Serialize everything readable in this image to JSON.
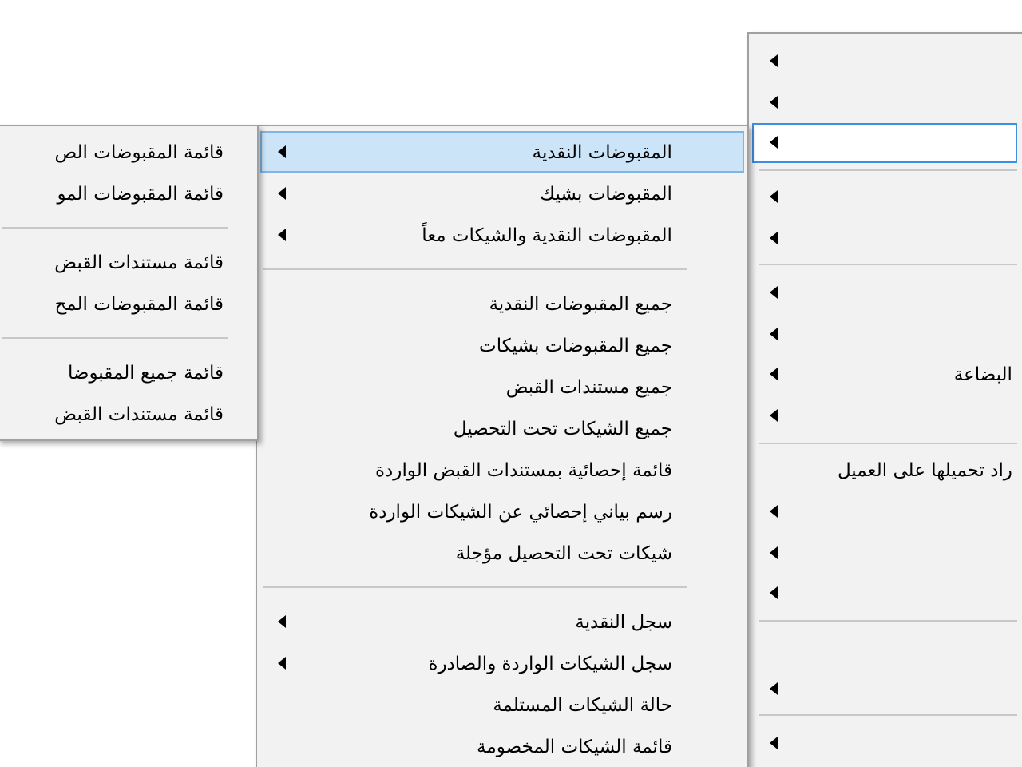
{
  "menus": [
    {
      "active": false,
      "items": [
        {
          "kind": "item",
          "submenu": true,
          "selected": false
        },
        {
          "kind": "item",
          "submenu": true,
          "selected": false
        },
        {
          "kind": "item",
          "submenu": true,
          "selected": true
        },
        {
          "kind": "separator"
        },
        {
          "kind": "item",
          "submenu": true,
          "selected": false
        },
        {
          "kind": "item",
          "submenu": true,
          "selected": false
        },
        {
          "kind": "separator"
        },
        {
          "kind": "item",
          "submenu": true,
          "selected": false
        },
        {
          "kind": "item",
          "submenu": true,
          "selected": false
        },
        {
          "kind": "item",
          "label": "البضاعة",
          "submenu": true,
          "selected": false
        },
        {
          "kind": "item",
          "submenu": true,
          "selected": false
        },
        {
          "kind": "separator"
        },
        {
          "kind": "item",
          "label": "راد تحميلها على العميل",
          "submenu": false,
          "selected": false
        },
        {
          "kind": "item",
          "submenu": true,
          "selected": false
        },
        {
          "kind": "item",
          "submenu": true,
          "selected": false
        },
        {
          "kind": "item",
          "submenu": true,
          "selected": false
        },
        {
          "kind": "separator"
        },
        {
          "kind": "blank"
        },
        {
          "kind": "item",
          "submenu": true,
          "selected": false
        },
        {
          "kind": "separator"
        },
        {
          "kind": "item",
          "submenu": true,
          "selected": false
        }
      ]
    },
    {
      "active": true,
      "items": [
        {
          "kind": "item",
          "label": "المقبوضات النقدية",
          "submenu": true,
          "selected": true
        },
        {
          "kind": "item",
          "label": "المقبوضات بشيك",
          "submenu": true,
          "selected": false
        },
        {
          "kind": "item",
          "label": "المقبوضات النقدية والشيكات معاً",
          "submenu": true,
          "selected": false
        },
        {
          "kind": "separator"
        },
        {
          "kind": "item",
          "label": "جميع المقبوضات النقدية",
          "submenu": false,
          "selected": false
        },
        {
          "kind": "item",
          "label": "جميع المقبوضات بشيكات",
          "submenu": false,
          "selected": false
        },
        {
          "kind": "item",
          "label": "جميع مستندات القبض",
          "submenu": false,
          "selected": false
        },
        {
          "kind": "item",
          "label": "جميع الشيكات تحت التحصيل",
          "submenu": false,
          "selected": false
        },
        {
          "kind": "item",
          "label": "قائمة إحصائية بمستندات القبض الواردة",
          "submenu": false,
          "selected": false
        },
        {
          "kind": "item",
          "label": "رسم بياني إحصائي عن الشيكات الواردة",
          "submenu": false,
          "selected": false
        },
        {
          "kind": "item",
          "label": "شيكات تحت التحصيل مؤجلة",
          "submenu": false,
          "selected": false
        },
        {
          "kind": "separator"
        },
        {
          "kind": "item",
          "label": "سجل النقدية",
          "submenu": true,
          "selected": false
        },
        {
          "kind": "item",
          "label": "سجل الشيكات الواردة والصادرة",
          "submenu": true,
          "selected": false
        },
        {
          "kind": "item",
          "label": "حالة الشيكات المستلمة",
          "submenu": false,
          "selected": false
        },
        {
          "kind": "item",
          "label": "قائمة الشيكات المخصومة",
          "submenu": false,
          "selected": false
        }
      ]
    },
    {
      "items": [
        {
          "kind": "item",
          "label": "قائمة المقبوضات الص",
          "submenu": false,
          "selected": false
        },
        {
          "kind": "item",
          "label": "قائمة المقبوضات المو",
          "submenu": false,
          "selected": false
        },
        {
          "kind": "separator"
        },
        {
          "kind": "item",
          "label": "قائمة مستندات القبض",
          "submenu": false,
          "selected": false
        },
        {
          "kind": "item",
          "label": "قائمة المقبوضات المح",
          "submenu": false,
          "selected": false
        },
        {
          "kind": "separator"
        },
        {
          "kind": "item",
          "label": "قائمة جميع المقبوضا",
          "submenu": false,
          "selected": false
        },
        {
          "kind": "item",
          "label": "قائمة مستندات القبض",
          "submenu": false,
          "selected": false
        }
      ]
    }
  ]
}
